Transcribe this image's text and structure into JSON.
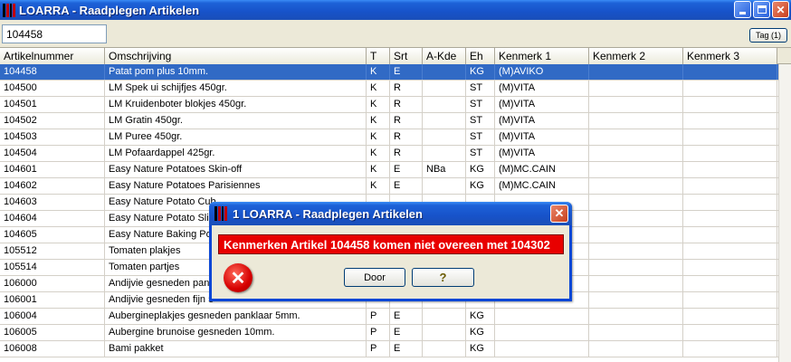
{
  "window": {
    "title": "LOARRA - Raadplegen Artikelen",
    "min_label": "",
    "max_label": "",
    "close_label": "✕"
  },
  "search": {
    "value": "104458"
  },
  "tag_button": {
    "label": "Tag (1)"
  },
  "grid": {
    "columns": [
      "Artikelnummer",
      "Omschrijving",
      "T",
      "Srt",
      "A-Kde",
      "Eh",
      "Kenmerk 1",
      "Kenmerk 2",
      "Kenmerk 3"
    ],
    "rows": [
      [
        "104458",
        "Patat pom plus 10mm.",
        "K",
        "E",
        "",
        "KG",
        "(M)AVIKO",
        "",
        ""
      ],
      [
        "104500",
        "LM Spek ui schijfjes 450gr.",
        "K",
        "R",
        "",
        "ST",
        "(M)VITA",
        "",
        ""
      ],
      [
        "104501",
        "LM Kruidenboter blokjes 450gr.",
        "K",
        "R",
        "",
        "ST",
        "(M)VITA",
        "",
        ""
      ],
      [
        "104502",
        "LM Gratin 450gr.",
        "K",
        "R",
        "",
        "ST",
        "(M)VITA",
        "",
        ""
      ],
      [
        "104503",
        "LM Puree 450gr.",
        "K",
        "R",
        "",
        "ST",
        "(M)VITA",
        "",
        ""
      ],
      [
        "104504",
        "LM Pofaardappel 425gr.",
        "K",
        "R",
        "",
        "ST",
        "(M)VITA",
        "",
        ""
      ],
      [
        "104601",
        "Easy Nature Potatoes Skin-off",
        "K",
        "E",
        "NBa",
        "KG",
        "(M)MC.CAIN",
        "",
        ""
      ],
      [
        "104602",
        "Easy Nature Potatoes Parisiennes",
        "K",
        "E",
        "",
        "KG",
        "(M)MC.CAIN",
        "",
        ""
      ],
      [
        "104603",
        "Easy Nature Potato Cub",
        "",
        "",
        "",
        "",
        "",
        "",
        ""
      ],
      [
        "104604",
        "Easy Nature Potato Slic",
        "",
        "",
        "",
        "",
        "",
        "",
        ""
      ],
      [
        "104605",
        "Easy Nature Baking Po",
        "",
        "",
        "",
        "",
        "",
        "",
        ""
      ],
      [
        "105512",
        "Tomaten plakjes",
        "",
        "",
        "",
        "",
        "",
        "",
        ""
      ],
      [
        "105514",
        "Tomaten partjes",
        "",
        "",
        "",
        "",
        "",
        "",
        ""
      ],
      [
        "106000",
        "Andijvie gesneden pank",
        "",
        "",
        "",
        "",
        "",
        "",
        ""
      ],
      [
        "106001",
        "Andijvie gesneden fijn 5",
        "",
        "",
        "",
        "",
        "",
        "",
        ""
      ],
      [
        "106004",
        "Aubergineplakjes gesneden panklaar 5mm.",
        "P",
        "E",
        "",
        "KG",
        "",
        "",
        ""
      ],
      [
        "106005",
        "Aubergine brunoise gesneden 10mm.",
        "P",
        "E",
        "",
        "KG",
        "",
        "",
        ""
      ],
      [
        "106008",
        "Bami pakket",
        "P",
        "E",
        "",
        "KG",
        "",
        "",
        ""
      ]
    ]
  },
  "dialog": {
    "title": "1 LOARRA - Raadplegen Artikelen",
    "message": "Kenmerken Artikel 104458 komen niet overeen met 104302",
    "ok_label": "Door",
    "help_label": "?",
    "close_label": "✕",
    "error_glyph": "✕"
  }
}
